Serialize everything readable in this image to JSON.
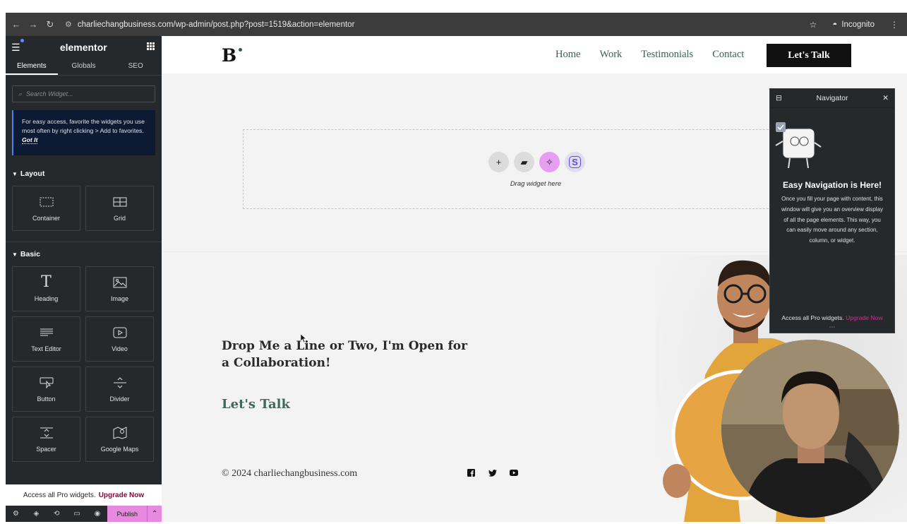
{
  "browser": {
    "url": "charliechangbusiness.com/wp-admin/post.php?post=1519&action=elementor",
    "incognito_label": "Incognito"
  },
  "panel": {
    "logo": "elementor",
    "tabs": [
      "Elements",
      "Globals",
      "SEO"
    ],
    "search_placeholder": "Search Widget...",
    "tip_text": "For easy access, favorite the widgets you use most often by right clicking > Add to favorites.",
    "tip_link": "Got It",
    "layout_title": "Layout",
    "layout_widgets": [
      "Container",
      "Grid"
    ],
    "basic_title": "Basic",
    "basic_widgets": [
      "Heading",
      "Image",
      "Text Editor",
      "Video",
      "Button",
      "Divider",
      "Spacer",
      "Google Maps"
    ],
    "promo_text": "Access all Pro widgets.",
    "promo_link": "Upgrade Now",
    "publish_label": "Publish"
  },
  "site": {
    "nav": [
      "Home",
      "Work",
      "Testimonials",
      "Contact"
    ],
    "cta": "Let's Talk",
    "dropzone_text": "Drag widget here",
    "headline": "Drop Me a Line or Two, I'm Open for a Collaboration!",
    "talk_link": "Let's Talk",
    "copyright": "© 2024 charliechangbusiness.com"
  },
  "navigator": {
    "title": "Navigator",
    "heading": "Easy Navigation is Here!",
    "body": "Once you fill your page with content, this window will give you an overview display of all the page elements. This way, you can easily move around any section, column, or widget.",
    "footer_text": "Access all Pro widgets.",
    "footer_link": "Upgrade Now"
  },
  "colors": {
    "panel_bg": "#26292c",
    "accent_pink": "#e889e0",
    "site_green": "#3c6a5c"
  }
}
